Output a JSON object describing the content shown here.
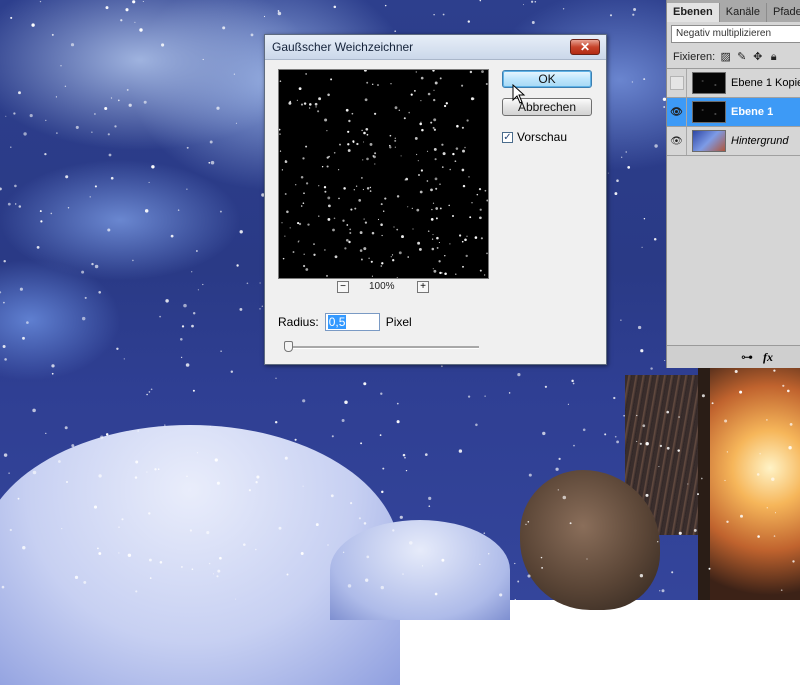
{
  "dialog": {
    "title": "Gaußscher Weichzeichner",
    "close_glyph": "✕",
    "ok_label": "OK",
    "cancel_label": "Abbrechen",
    "preview_label": "Vorschau",
    "preview_checked": true,
    "zoom_out": "−",
    "zoom_in": "+",
    "zoom_level": "100%",
    "radius_label": "Radius:",
    "radius_value": "0,5",
    "unit_label": "Pixel"
  },
  "layers_panel": {
    "tabs": [
      "Ebenen",
      "Kanäle",
      "Pfade"
    ],
    "blend_mode": "Negativ multiplizieren",
    "lock_label": "Fixieren:",
    "layers": [
      {
        "name": "Ebene 1 Kopie",
        "visible": false,
        "selected": false
      },
      {
        "name": "Ebene 1",
        "visible": true,
        "selected": true
      },
      {
        "name": "Hintergrund",
        "visible": true,
        "selected": false
      }
    ],
    "footer_icons": [
      "link-icon",
      "fx-icon"
    ],
    "fx_label": "fx"
  },
  "colors": {
    "selection": "#3d9af6",
    "dialog_bg": "#f0f0f0",
    "close_red": "#c7442b"
  }
}
